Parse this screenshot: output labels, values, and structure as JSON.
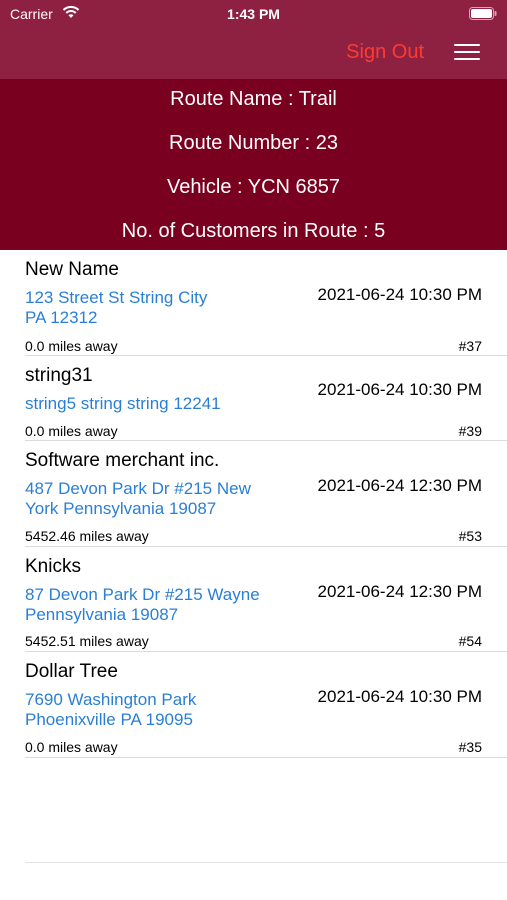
{
  "status_bar": {
    "carrier": "Carrier",
    "time": "1:43 PM"
  },
  "nav": {
    "sign_out_label": "Sign Out"
  },
  "route_info": {
    "route_name": "Route Name : Trail",
    "route_number": "Route Number : 23",
    "vehicle": "Vehicle : YCN 6857",
    "customers_count": "No. of Customers in Route : 5"
  },
  "customers": [
    {
      "name": "New Name",
      "address_line1": "123 Street St String City",
      "address_line2": "PA 12312",
      "datetime": "2021-06-24 10:30 PM",
      "distance": "0.0 miles away",
      "number": "#37"
    },
    {
      "name": "string31",
      "address_line1": "string5 string string 12241",
      "address_line2": "",
      "datetime": "2021-06-24 10:30 PM",
      "distance": "0.0 miles away",
      "number": "#39"
    },
    {
      "name": "Software merchant inc.",
      "address_line1": "487 Devon Park Dr #215 New",
      "address_line2": "York Pennsylvania 19087",
      "datetime": "2021-06-24 12:30 PM",
      "distance": "5452.46 miles away",
      "number": "#53"
    },
    {
      "name": "Knicks",
      "address_line1": "87 Devon Park Dr #215 Wayne",
      "address_line2": "Pennsylvania 19087",
      "datetime": "2021-06-24 12:30 PM",
      "distance": "5452.51 miles away",
      "number": "#54"
    },
    {
      "name": "Dollar Tree",
      "address_line1": "7690 Washington Park",
      "address_line2": "Phoenixville PA 19095",
      "datetime": "2021-06-24 10:30 PM",
      "distance": "0.0 miles away",
      "number": "#35"
    }
  ]
}
